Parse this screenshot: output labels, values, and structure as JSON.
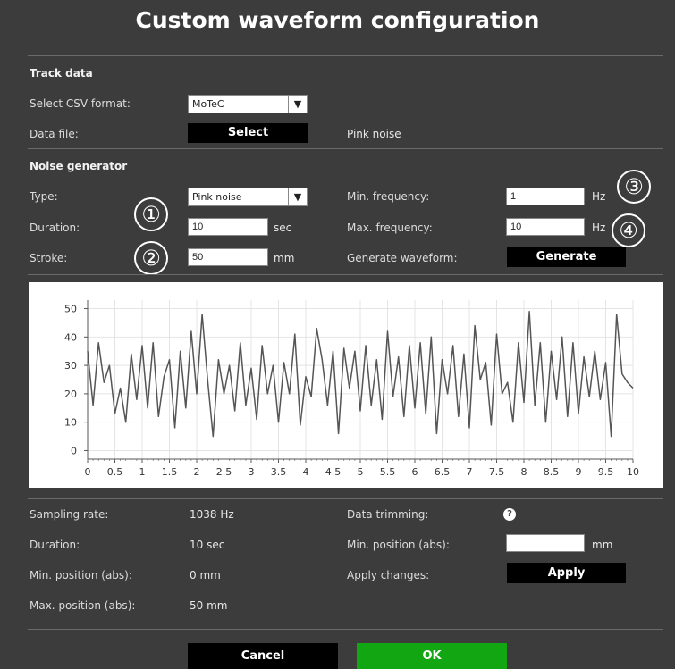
{
  "title": "Custom waveform configuration",
  "track_data": {
    "section": "Track data",
    "csv_format_label": "Select CSV format:",
    "csv_format_value": "MoTeC",
    "data_file_label": "Data file:",
    "select_button": "Select",
    "data_file_value": "Pink noise"
  },
  "noise": {
    "section": "Noise generator",
    "type_label": "Type:",
    "type_value": "Pink noise",
    "duration_label": "Duration:",
    "duration_value": "10",
    "duration_unit": "sec",
    "stroke_label": "Stroke:",
    "stroke_value": "50",
    "stroke_unit": "mm",
    "min_freq_label": "Min. frequency:",
    "min_freq_value": "1",
    "min_freq_unit": "Hz",
    "max_freq_label": "Max. frequency:",
    "max_freq_value": "10",
    "max_freq_unit": "Hz",
    "generate_label": "Generate waveform:",
    "generate_button": "Generate"
  },
  "markers": [
    "①",
    "②",
    "③",
    "④"
  ],
  "chart_data": {
    "type": "line",
    "xlim": [
      0,
      10
    ],
    "ylim": [
      -3,
      53
    ],
    "grid": true,
    "x_ticks": [
      "0",
      "0.5",
      "1",
      "1.5",
      "2",
      "2.5",
      "3",
      "3.5",
      "4",
      "4.5",
      "5",
      "5.5",
      "6",
      "6.5",
      "7",
      "7.5",
      "8",
      "8.5",
      "9",
      "9.5",
      "10"
    ],
    "y_ticks": [
      "50",
      "40",
      "30",
      "20",
      "10",
      "0"
    ],
    "x": [
      0,
      0.1,
      0.2,
      0.3,
      0.4,
      0.5,
      0.6,
      0.7,
      0.8,
      0.9,
      1.0,
      1.1,
      1.2,
      1.3,
      1.4,
      1.5,
      1.6,
      1.7,
      1.8,
      1.9,
      2.0,
      2.1,
      2.2,
      2.3,
      2.4,
      2.5,
      2.6,
      2.7,
      2.8,
      2.9,
      3.0,
      3.1,
      3.2,
      3.3,
      3.4,
      3.5,
      3.6,
      3.7,
      3.8,
      3.9,
      4.0,
      4.1,
      4.2,
      4.3,
      4.4,
      4.5,
      4.6,
      4.7,
      4.8,
      4.9,
      5.0,
      5.1,
      5.2,
      5.3,
      5.4,
      5.5,
      5.6,
      5.7,
      5.8,
      5.9,
      6.0,
      6.1,
      6.2,
      6.3,
      6.4,
      6.5,
      6.6,
      6.7,
      6.8,
      6.9,
      7.0,
      7.1,
      7.2,
      7.3,
      7.4,
      7.5,
      7.6,
      7.7,
      7.8,
      7.9,
      8.0,
      8.1,
      8.2,
      8.3,
      8.4,
      8.5,
      8.6,
      8.7,
      8.8,
      8.9,
      9.0,
      9.1,
      9.2,
      9.3,
      9.4,
      9.5,
      9.6,
      9.7,
      9.8,
      9.9,
      10.0
    ],
    "y": [
      35,
      16,
      38,
      24,
      30,
      13,
      22,
      10,
      34,
      18,
      37,
      15,
      38,
      12,
      26,
      32,
      8,
      35,
      15,
      42,
      20,
      48,
      25,
      5,
      32,
      20,
      30,
      14,
      38,
      16,
      29,
      11,
      37,
      20,
      30,
      10,
      31,
      20,
      41,
      9,
      26,
      19,
      43,
      32,
      16,
      35,
      6,
      36,
      22,
      35,
      14,
      37,
      16,
      32,
      11,
      42,
      19,
      33,
      12,
      37,
      15,
      38,
      13,
      40,
      6,
      32,
      20,
      37,
      12,
      34,
      8,
      44,
      25,
      31,
      9,
      41,
      20,
      24,
      10,
      38,
      17,
      49,
      16,
      38,
      10,
      35,
      18,
      40,
      12,
      38,
      13,
      33,
      19,
      35,
      18,
      31,
      5,
      48,
      27,
      24,
      22
    ]
  },
  "info": {
    "sampling_rate_label": "Sampling rate:",
    "sampling_rate_value": "1038 Hz",
    "duration_label": "Duration:",
    "duration_value": "10 sec",
    "min_pos_label": "Min. position (abs):",
    "min_pos_value": "0 mm",
    "max_pos_label": "Max. position (abs):",
    "max_pos_value": "50 mm",
    "trimming_label": "Data trimming:",
    "help_icon": "?",
    "trim_min_label": "Min. position (abs):",
    "trim_min_value": "",
    "trim_min_unit": "mm",
    "apply_label": "Apply changes:",
    "apply_button": "Apply"
  },
  "footer": {
    "cancel_button": "Cancel",
    "ok_button": "OK"
  }
}
